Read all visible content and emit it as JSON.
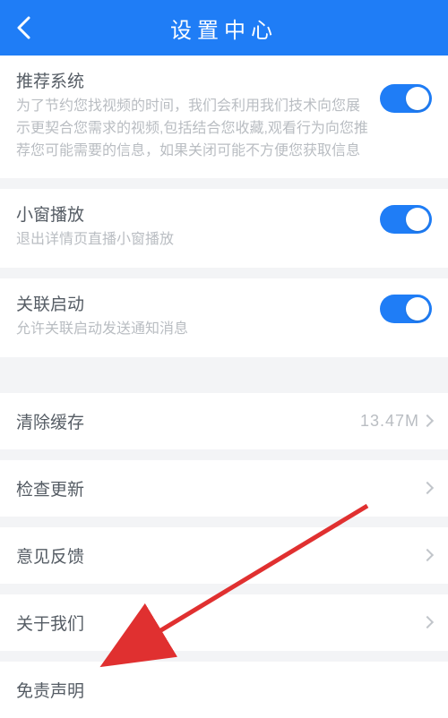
{
  "header": {
    "title": "设置中心"
  },
  "sections": {
    "recommend": {
      "title": "推荐系统",
      "desc": "为了节约您找视频的时间，我们会利用我们技术向您展示更契合您需求的视频,包括结合您收藏,观看行为向您推荐您可能需要的信息，如果关闭可能不方便您获取信息"
    },
    "mini_window": {
      "title": "小窗播放",
      "desc": "退出详情页直播小窗播放"
    },
    "related_launch": {
      "title": "关联启动",
      "desc": "允许关联启动发送通知消息"
    }
  },
  "rows": {
    "clear_cache": {
      "title": "清除缓存",
      "value": "13.47M"
    },
    "check_update": {
      "title": "检查更新"
    },
    "feedback": {
      "title": "意见反馈"
    },
    "about": {
      "title": "关于我们"
    },
    "disclaimer": {
      "title": "免责声明"
    }
  }
}
